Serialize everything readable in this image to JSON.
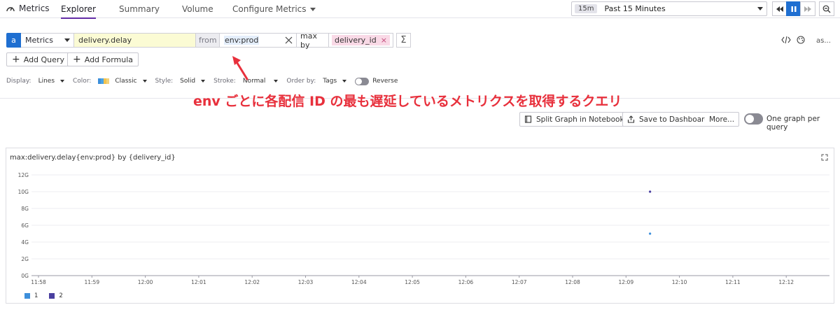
{
  "nav": {
    "brand": "Metrics",
    "tabs": [
      {
        "label": "Explorer",
        "active": true
      },
      {
        "label": "Summary"
      },
      {
        "label": "Volume"
      },
      {
        "label": "Configure Metrics"
      }
    ],
    "time_badge": "15m",
    "time_label": "Past 15 Minutes"
  },
  "query": {
    "letter": "a",
    "source": "Metrics",
    "metric": "delivery.delay",
    "from_label": "from",
    "filter": "env:prod",
    "agg_label": "max by",
    "group_tag": "delivery_id",
    "sigma": "Σ",
    "as_label": "as..."
  },
  "buttons": {
    "add_query": "Add Query",
    "add_formula": "Add Formula"
  },
  "options": {
    "display_label": "Display:",
    "display_value": "Lines",
    "color_label": "Color:",
    "color_value": "Classic",
    "style_label": "Style:",
    "style_value": "Solid",
    "stroke_label": "Stroke:",
    "stroke_value": "Normal",
    "order_label": "Order by:",
    "order_value": "Tags",
    "reverse_label": "Reverse",
    "palette": [
      "#3d8fdb",
      "#4aa3e6",
      "#f1c24f",
      "#f2d27a"
    ]
  },
  "annotation": "env ごとに各配信 ID の最も遅延しているメトリクスを取得するクエリ",
  "graph_toolbar": {
    "split": "Split Graph in Notebook",
    "save": "Save to Dashboard",
    "more": "More...",
    "one_graph": "One graph per query"
  },
  "colors": {
    "accent": "#1f6fd1",
    "annotation": "#e8303c",
    "series_1": "#3d8fdb",
    "series_2": "#4a3fa0"
  },
  "chart_data": {
    "type": "scatter",
    "title": "max:delivery.delay{env:prod} by {delivery_id}",
    "x_ticks": [
      "11:58",
      "11:59",
      "12:00",
      "12:01",
      "12:02",
      "12:03",
      "12:04",
      "12:05",
      "12:06",
      "12:07",
      "12:08",
      "12:09",
      "12:10",
      "12:11",
      "12:12"
    ],
    "y_ticks": [
      "0G",
      "2G",
      "4G",
      "6G",
      "8G",
      "10G",
      "12G"
    ],
    "ylim": [
      0,
      12
    ],
    "grid": true,
    "legend": "bottom-left",
    "series": [
      {
        "name": "1",
        "color": "#3d8fdb",
        "points": [
          {
            "x": "12:09:27",
            "y": 5.0
          }
        ]
      },
      {
        "name": "2",
        "color": "#4a3fa0",
        "points": [
          {
            "x": "12:09:27",
            "y": 10.0
          }
        ]
      }
    ]
  }
}
